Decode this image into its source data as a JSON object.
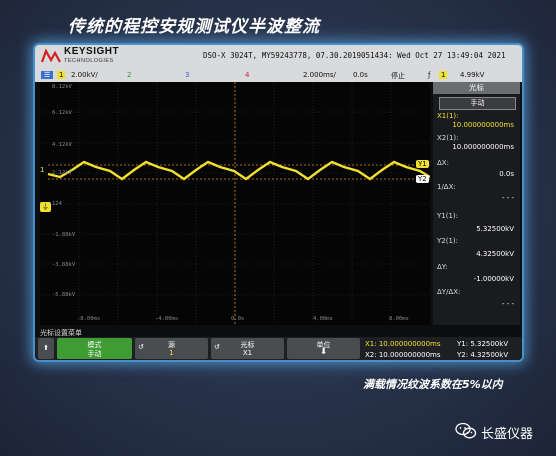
{
  "page": {
    "title": "传统的程控安规测试仪半波整流",
    "note": "满载情况纹波系数在5%以内",
    "brand_name": "长盛仪器"
  },
  "scope": {
    "brand": "KEYSIGHT",
    "brand_sub": "TECHNOLOGIES",
    "info": "DSO-X 3024T, MY59243778, 07.30.2019051434: Wed Oct 27 13:49:04 2021",
    "status": {
      "ch1": "1",
      "ch1_scale": "2.00kV/",
      "ch2": "2",
      "ch3": "3",
      "ch4": "4",
      "timebase": "2.000ms/",
      "delay": "0.0s",
      "run_state": "停止",
      "trig_ch": "1",
      "trig_level": "4.99kV"
    },
    "y_labels": [
      "8.12kV",
      "6.12kV",
      "4.12kV",
      "2.12kV",
      "124",
      "-1.88kV",
      "-3.88kV",
      "-5.88kV"
    ],
    "x_labels": [
      "-8.00ms",
      "-4.00ms",
      "0.0s",
      "4.00ms",
      "8.00ms"
    ],
    "cursor_tags": {
      "y1": "Y1",
      "y2": "Y2",
      "ch1_marker": "1"
    },
    "panel": {
      "title": "光标",
      "mode": "手动",
      "x1_label": "X1(1):",
      "x1_value": "10.000000000ms",
      "x2_label": "X2(1):",
      "x2_value": "10.000000000ms",
      "dx_label": "ΔX:",
      "dx_value": "0.0s",
      "inv_dx_label": "1/ΔX:",
      "inv_dx_value": "- - -",
      "y1_label": "Y1(1):",
      "y1_value": "5.32500kV",
      "y2_label": "Y2(1):",
      "y2_value": "4.32500kV",
      "dy_label": "ΔY:",
      "dy_value": "-1.00000kV",
      "dydx_label": "ΔY/ΔX:",
      "dydx_value": "- - -"
    },
    "softkey_menu_title": "光标设置菜单",
    "softkeys": {
      "mode_label": "模式",
      "mode_value": "手动",
      "source_label": "源",
      "source_value": "1",
      "cursor_label": "光标",
      "cursor_value": "X1",
      "units_label": "单位"
    },
    "readout": {
      "x1": "X1: 10.000000000ms",
      "x2": "X2: 10.000000000ms",
      "y1": "Y1: 5.32500kV",
      "y2": "Y2: 4.32500kV"
    },
    "colors": {
      "ch1": "#f0e030",
      "ch2": "#3fd04a",
      "ch3": "#5a8cf0",
      "ch4": "#f04060",
      "glow": "#5aaaeb"
    }
  }
}
